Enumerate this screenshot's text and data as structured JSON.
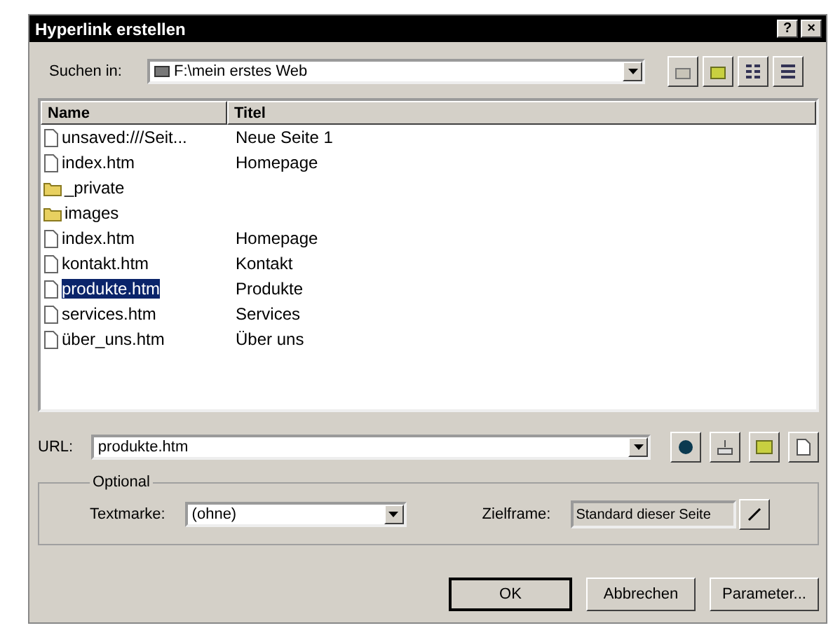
{
  "window": {
    "title": "Hyperlink erstellen",
    "title_buttons": [
      "?",
      "×"
    ]
  },
  "look_in": {
    "label": "Suchen in:",
    "value": "F:\\mein erstes Web"
  },
  "list": {
    "columns": [
      "Name",
      "Titel"
    ],
    "rows": [
      {
        "kind": "page",
        "name": "unsaved:///Seit...",
        "title": "Neue Seite 1",
        "selected": false
      },
      {
        "kind": "page",
        "name": "index.htm",
        "title": "Homepage",
        "selected": false
      },
      {
        "kind": "folder",
        "name": "_private",
        "title": "",
        "selected": false
      },
      {
        "kind": "folder",
        "name": "images",
        "title": "",
        "selected": false
      },
      {
        "kind": "page",
        "name": "index.htm",
        "title": "Homepage",
        "selected": false
      },
      {
        "kind": "page",
        "name": "kontakt.htm",
        "title": "Kontakt",
        "selected": false
      },
      {
        "kind": "page",
        "name": "produkte.htm",
        "title": "Produkte",
        "selected": true
      },
      {
        "kind": "page",
        "name": "services.htm",
        "title": "Services",
        "selected": false
      },
      {
        "kind": "page",
        "name": "über_uns.htm",
        "title": "Über uns",
        "selected": false
      }
    ]
  },
  "url": {
    "label": "URL:",
    "value": "produkte.htm"
  },
  "optional": {
    "legend": "Optional",
    "bookmark_label": "Textmarke:",
    "bookmark_value": "(ohne)",
    "frame_label": "Zielframe:",
    "frame_value": "Standard dieser Seite"
  },
  "buttons": [
    "OK",
    "Abbrechen",
    "Parameter..."
  ]
}
